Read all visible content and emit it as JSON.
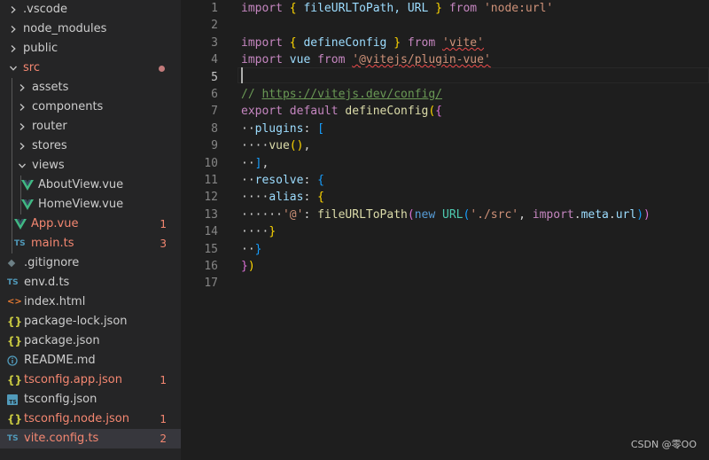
{
  "explorer": {
    "items": [
      {
        "label": ".vscode",
        "kind": "folder",
        "state": "collapsed",
        "depth": 0
      },
      {
        "label": "node_modules",
        "kind": "folder",
        "state": "collapsed",
        "depth": 0
      },
      {
        "label": "public",
        "kind": "folder",
        "state": "collapsed",
        "depth": 0
      },
      {
        "label": "src",
        "kind": "folder",
        "state": "expanded",
        "depth": 0,
        "modified": true
      },
      {
        "label": "assets",
        "kind": "folder",
        "state": "collapsed",
        "depth": 1
      },
      {
        "label": "components",
        "kind": "folder",
        "state": "collapsed",
        "depth": 1
      },
      {
        "label": "router",
        "kind": "folder",
        "state": "collapsed",
        "depth": 1
      },
      {
        "label": "stores",
        "kind": "folder",
        "state": "collapsed",
        "depth": 1
      },
      {
        "label": "views",
        "kind": "folder",
        "state": "expanded",
        "depth": 1
      },
      {
        "label": "AboutView.vue",
        "kind": "vue",
        "depth": 2
      },
      {
        "label": "HomeView.vue",
        "kind": "vue",
        "depth": 2
      },
      {
        "label": "App.vue",
        "kind": "vue",
        "depth": 1,
        "badge": "1"
      },
      {
        "label": "main.ts",
        "kind": "ts",
        "depth": 1,
        "badge": "3"
      },
      {
        "label": ".gitignore",
        "kind": "gitignore",
        "depth": 0
      },
      {
        "label": "env.d.ts",
        "kind": "ts",
        "depth": 0
      },
      {
        "label": "index.html",
        "kind": "html",
        "depth": 0
      },
      {
        "label": "package-lock.json",
        "kind": "json",
        "depth": 0
      },
      {
        "label": "package.json",
        "kind": "json",
        "depth": 0
      },
      {
        "label": "README.md",
        "kind": "info",
        "depth": 0
      },
      {
        "label": "tsconfig.app.json",
        "kind": "json",
        "depth": 0,
        "badge": "1"
      },
      {
        "label": "tsconfig.json",
        "kind": "tsconfig",
        "depth": 0
      },
      {
        "label": "tsconfig.node.json",
        "kind": "json",
        "depth": 0,
        "badge": "1"
      },
      {
        "label": "vite.config.ts",
        "kind": "ts",
        "depth": 0,
        "badge": "2",
        "active": true
      }
    ]
  },
  "editor": {
    "line_numbers": [
      "1",
      "2",
      "3",
      "4",
      "5",
      "6",
      "7",
      "8",
      "9",
      "10",
      "11",
      "12",
      "13",
      "14",
      "15",
      "16",
      "17"
    ],
    "current_line": "5",
    "lines": [
      [
        {
          "t": "import",
          "c": "kw"
        },
        {
          "t": " ",
          "c": "p"
        },
        {
          "t": "{",
          "c": "b1"
        },
        {
          "t": " fileURLToPath, URL ",
          "c": "var"
        },
        {
          "t": "}",
          "c": "b1"
        },
        {
          "t": " ",
          "c": "p"
        },
        {
          "t": "from",
          "c": "kw"
        },
        {
          "t": " ",
          "c": "p"
        },
        {
          "t": "'node:url'",
          "c": "str"
        }
      ],
      [],
      [
        {
          "t": "import",
          "c": "kw"
        },
        {
          "t": " ",
          "c": "p"
        },
        {
          "t": "{",
          "c": "b1"
        },
        {
          "t": " defineConfig ",
          "c": "var"
        },
        {
          "t": "}",
          "c": "b1"
        },
        {
          "t": " ",
          "c": "p"
        },
        {
          "t": "from",
          "c": "kw"
        },
        {
          "t": " ",
          "c": "p"
        },
        {
          "t": "'vite'",
          "c": "str",
          "sq": true
        }
      ],
      [
        {
          "t": "import",
          "c": "kw"
        },
        {
          "t": " ",
          "c": "p"
        },
        {
          "t": "vue",
          "c": "var"
        },
        {
          "t": " ",
          "c": "p"
        },
        {
          "t": "from",
          "c": "kw"
        },
        {
          "t": " ",
          "c": "p"
        },
        {
          "t": "'@vitejs/plugin-vue'",
          "c": "str",
          "sq": true
        }
      ],
      [],
      [
        {
          "t": "// ",
          "c": "cm"
        },
        {
          "t": "https://vitejs.dev/config/",
          "c": "url"
        }
      ],
      [
        {
          "t": "export",
          "c": "kw"
        },
        {
          "t": " ",
          "c": "p"
        },
        {
          "t": "default",
          "c": "kw"
        },
        {
          "t": " ",
          "c": "p"
        },
        {
          "t": "defineConfig",
          "c": "fn"
        },
        {
          "t": "(",
          "c": "b1"
        },
        {
          "t": "{",
          "c": "b2"
        }
      ],
      [
        {
          "t": "··",
          "c": "ws"
        },
        {
          "t": "plugins",
          "c": "var"
        },
        {
          "t": ": ",
          "c": "p"
        },
        {
          "t": "[",
          "c": "b3"
        }
      ],
      [
        {
          "t": "····",
          "c": "ws"
        },
        {
          "t": "vue",
          "c": "fn"
        },
        {
          "t": "(",
          "c": "b1"
        },
        {
          "t": ")",
          "c": "b1"
        },
        {
          "t": ",",
          "c": "p"
        }
      ],
      [
        {
          "t": "··",
          "c": "ws"
        },
        {
          "t": "]",
          "c": "b3"
        },
        {
          "t": ",",
          "c": "p"
        }
      ],
      [
        {
          "t": "··",
          "c": "ws"
        },
        {
          "t": "resolve",
          "c": "var"
        },
        {
          "t": ": ",
          "c": "p"
        },
        {
          "t": "{",
          "c": "b3"
        }
      ],
      [
        {
          "t": "····",
          "c": "ws"
        },
        {
          "t": "alias",
          "c": "var"
        },
        {
          "t": ": ",
          "c": "p"
        },
        {
          "t": "{",
          "c": "b1"
        }
      ],
      [
        {
          "t": "······",
          "c": "ws"
        },
        {
          "t": "'@'",
          "c": "str"
        },
        {
          "t": ": ",
          "c": "p"
        },
        {
          "t": "fileURLToPath",
          "c": "fn"
        },
        {
          "t": "(",
          "c": "b2"
        },
        {
          "t": "new",
          "c": "blue"
        },
        {
          "t": " ",
          "c": "p"
        },
        {
          "t": "URL",
          "c": "obj"
        },
        {
          "t": "(",
          "c": "b3"
        },
        {
          "t": "'./src'",
          "c": "str"
        },
        {
          "t": ", ",
          "c": "p"
        },
        {
          "t": "import",
          "c": "kw"
        },
        {
          "t": ".",
          "c": "p"
        },
        {
          "t": "meta",
          "c": "var"
        },
        {
          "t": ".",
          "c": "p"
        },
        {
          "t": "url",
          "c": "var"
        },
        {
          "t": ")",
          "c": "b3"
        },
        {
          "t": ")",
          "c": "b2"
        }
      ],
      [
        {
          "t": "····",
          "c": "ws"
        },
        {
          "t": "}",
          "c": "b1"
        }
      ],
      [
        {
          "t": "··",
          "c": "ws"
        },
        {
          "t": "}",
          "c": "b3"
        }
      ],
      [
        {
          "t": "}",
          "c": "b2"
        },
        {
          "t": ")",
          "c": "b1"
        }
      ],
      []
    ]
  },
  "watermark": "CSDN @零OO",
  "colors": {
    "sidebar_bg": "#252526",
    "editor_bg": "#1e1e1e",
    "error_text": "#f48771",
    "vue_icon": "#41b883",
    "ts_icon": "#519aba",
    "json_icon": "#cbcb41",
    "html_icon": "#e37933"
  }
}
